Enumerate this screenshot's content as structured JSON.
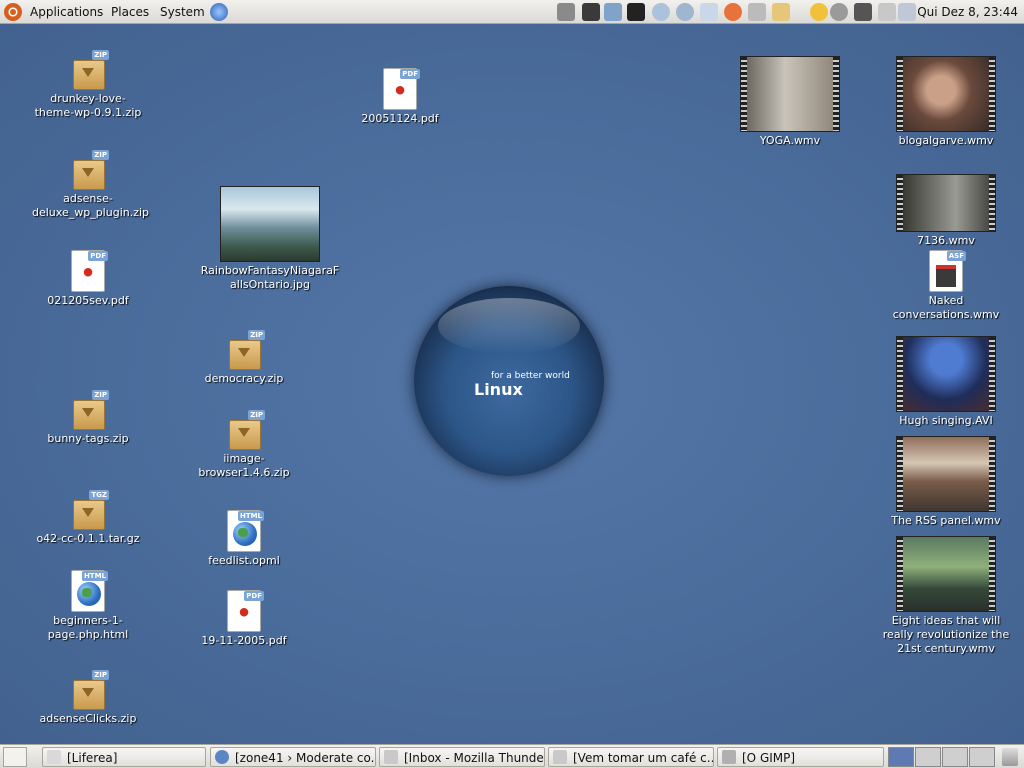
{
  "top_panel": {
    "menus": [
      "Applications",
      "Places",
      "System"
    ],
    "clock": "Qui Dez  8, 23:44"
  },
  "desktop_icons": [
    {
      "label": "drunkey-love-theme-wp-0.9.1.zip",
      "type": "zip"
    },
    {
      "label": "adsense-deluxe_wp_plugin.zip",
      "type": "zip"
    },
    {
      "label": "021205sev.pdf",
      "type": "pdf"
    },
    {
      "label": "bunny-tags.zip",
      "type": "zip"
    },
    {
      "label": "o42-cc-0.1.1.tar.gz",
      "type": "tgz"
    },
    {
      "label": "beginners-1-page.php.html",
      "type": "html"
    },
    {
      "label": "adsenseClicks.zip",
      "type": "zip"
    },
    {
      "label": "20051124.pdf",
      "type": "pdf"
    },
    {
      "label": "RainbowFantasyNiagaraFallsOntario.jpg",
      "type": "jpg"
    },
    {
      "label": "democracy.zip",
      "type": "zip"
    },
    {
      "label": "iimage-browser1.4.6.zip",
      "type": "zip"
    },
    {
      "label": "feedlist.opml",
      "type": "html"
    },
    {
      "label": "19-11-2005.pdf",
      "type": "pdf"
    },
    {
      "label": "YOGA.wmv",
      "type": "video"
    },
    {
      "label": "blogalgarve.wmv",
      "type": "video"
    },
    {
      "label": "7136.wmv",
      "type": "video"
    },
    {
      "label": "Naked conversations.wmv",
      "type": "asf"
    },
    {
      "label": "Hugh singing.AVI",
      "type": "video"
    },
    {
      "label": "The RSS panel.wmv",
      "type": "video"
    },
    {
      "label": "Eight ideas that will really revolutionize the 21st century.wmv",
      "type": "video"
    }
  ],
  "badges": {
    "zip": "ZIP",
    "pdf": "PDF",
    "html": "HTML",
    "tgz": "TGZ",
    "asf": "ASF"
  },
  "wallpaper": {
    "tagline": "for a better world",
    "word": "Linux"
  },
  "taskbar": [
    {
      "label": "[Liferea]"
    },
    {
      "label": "[zone41 › Moderate co..."
    },
    {
      "label": "[Inbox - Mozilla Thunde..."
    },
    {
      "label": "[Vem tomar um café c..."
    },
    {
      "label": "[O GIMP]"
    }
  ],
  "colors": {
    "desktop": "#4c6e9c",
    "panel": "#e8e6e1",
    "pdf_red": "#d52a1e"
  }
}
